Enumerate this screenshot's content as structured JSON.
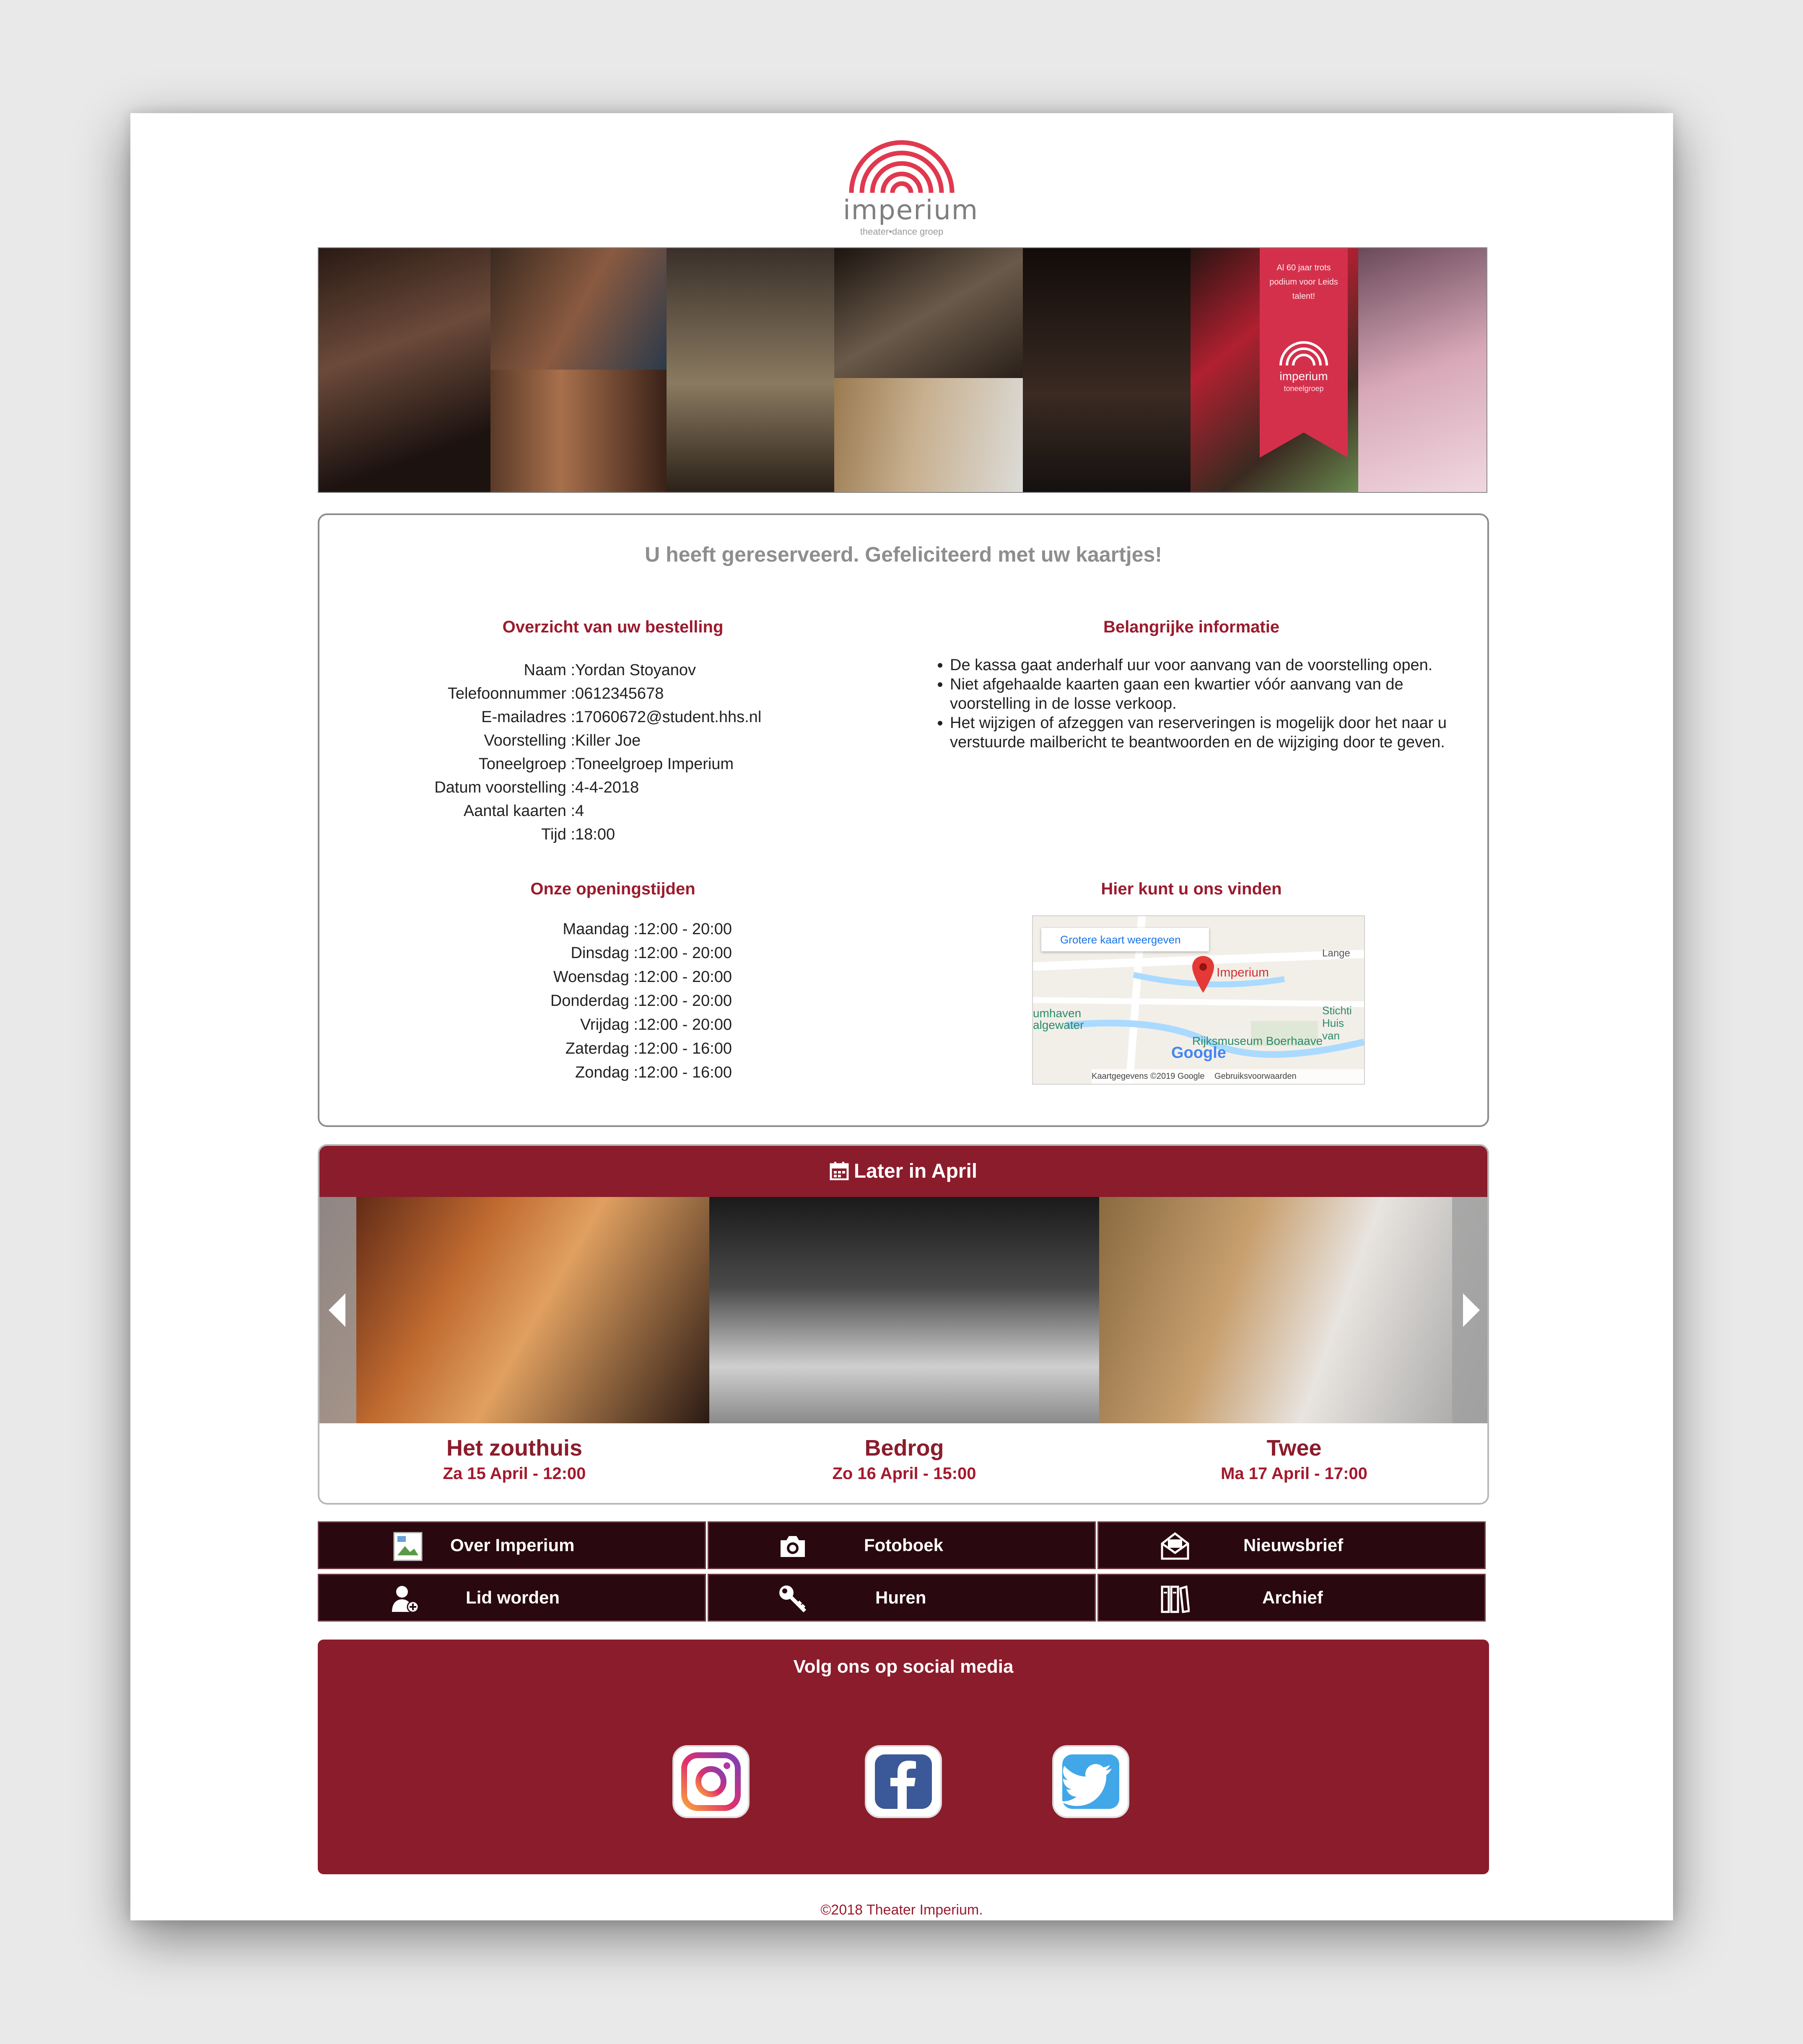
{
  "logo": {
    "wordmark": "imperium",
    "tagline": "theater•dance groep"
  },
  "banner": {
    "ribbon_text": "Al 60 jaar trots podium voor Leids talent!",
    "ribbon_logo": "imperium",
    "ribbon_tagline": "toneelgroep"
  },
  "confirmation": {
    "title": "U heeft gereserveerd. Gefeliciteerd met uw kaartjes!",
    "order_heading": "Overzicht van uw bestelling",
    "order": [
      {
        "label": "Naam :",
        "value": "Yordan Stoyanov"
      },
      {
        "label": "Telefoonnummer :",
        "value": "0612345678"
      },
      {
        "label": "E-mailadres :",
        "value": "17060672@student.hhs.nl"
      },
      {
        "label": "Voorstelling :",
        "value": "Killer Joe"
      },
      {
        "label": "Toneelgroep :",
        "value": "Toneelgroep Imperium"
      },
      {
        "label": "Datum voorstelling :",
        "value": "4-4-2018"
      },
      {
        "label": "Aantal kaarten :",
        "value": "4"
      },
      {
        "label": "Tijd :",
        "value": "18:00"
      }
    ],
    "info_heading": "Belangrijke informatie",
    "info": [
      "De kassa gaat anderhalf uur voor aanvang van de voorstelling open.",
      "Niet afgehaalde kaarten gaan een kwartier vóór aanvang van de voorstelling in de losse verkoop.",
      "Het wijzigen of afzeggen van reserveringen is mogelijk door het naar u verstuurde mailbericht te beantwoorden en de wijziging door te geven."
    ],
    "hours_heading": "Onze openingstijden",
    "hours": [
      {
        "day": "Maandag :",
        "time": "12:00 - 20:00"
      },
      {
        "day": "Dinsdag :",
        "time": "12:00 - 20:00"
      },
      {
        "day": "Woensdag :",
        "time": "12:00 - 20:00"
      },
      {
        "day": "Donderdag :",
        "time": "12:00 - 20:00"
      },
      {
        "day": "Vrijdag :",
        "time": "12:00 - 20:00"
      },
      {
        "day": "Zaterdag :",
        "time": "12:00 - 16:00"
      },
      {
        "day": "Zondag :",
        "time": "12:00 - 16:00"
      }
    ],
    "map_heading": "Hier kunt u ons vinden",
    "map": {
      "larger_map_link": "Grotere kaart weergeven",
      "marker_label": "Imperium",
      "place_1": "Rijksmuseum Boerhaave",
      "place_2": "Stichti Huis van",
      "place_3": "umhaven algewater",
      "place_4": "Lange",
      "google": "Google",
      "attribution": "Kaartgegevens ©2019 Google",
      "terms": "Gebruiksvoorwaarden"
    }
  },
  "later": {
    "heading": "Later in April",
    "shows": [
      {
        "title": "Het zouthuis",
        "date": "Za 15 April - 12:00"
      },
      {
        "title": "Bedrog",
        "date": "Zo 16 April - 15:00"
      },
      {
        "title": "Twee",
        "date": "Ma 17 April - 17:00"
      }
    ]
  },
  "menu": [
    {
      "label": "Over Imperium",
      "icon": "broken-image-icon"
    },
    {
      "label": "Fotoboek",
      "icon": "camera-icon"
    },
    {
      "label": "Nieuwsbrief",
      "icon": "envelope-icon"
    },
    {
      "label": "Lid worden",
      "icon": "add-user-icon"
    },
    {
      "label": "Huren",
      "icon": "key-icon"
    },
    {
      "label": "Archief",
      "icon": "archive-icon"
    }
  ],
  "social": {
    "heading": "Volg ons op social media",
    "icons": [
      "instagram-icon",
      "facebook-icon",
      "twitter-icon"
    ]
  },
  "footer": "©2018 Theater Imperium.",
  "colors": {
    "brand": "#8b1c2c",
    "menu_bg": "#2a0810",
    "accent_red": "#d4304c"
  }
}
